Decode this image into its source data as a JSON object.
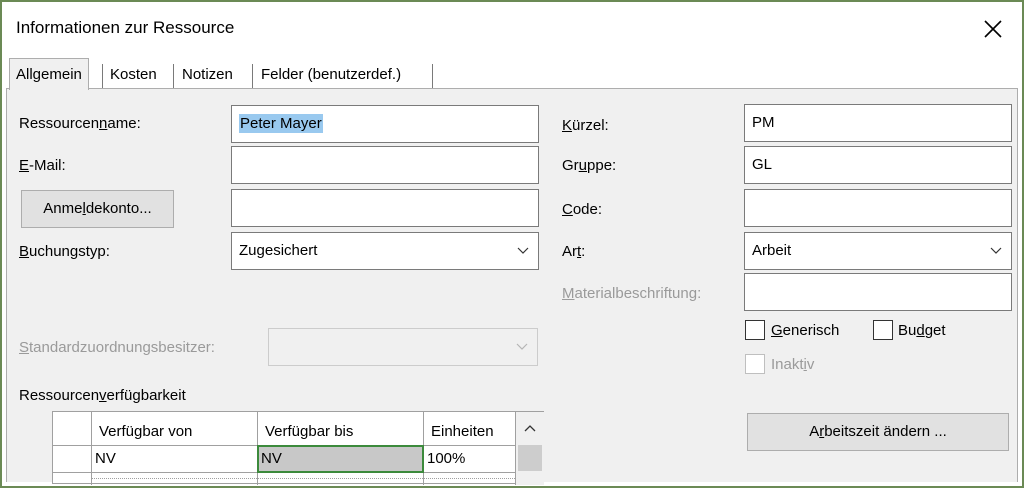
{
  "window": {
    "title": "Informationen zur Ressource"
  },
  "tabs": [
    {
      "label": "Allgemein",
      "selected": true
    },
    {
      "label": "Kosten",
      "selected": false
    },
    {
      "label": "Notizen",
      "selected": false
    },
    {
      "label": "Felder (benutzerdef.)",
      "selected": false
    }
  ],
  "form": {
    "resource_name": {
      "label_pre": "Ressourcen",
      "label_ul": "n",
      "label_post": "ame:",
      "value": "Peter Mayer"
    },
    "email": {
      "label_pre": "",
      "label_ul": "E",
      "label_post": "-Mail:",
      "value": ""
    },
    "login_button": {
      "label_pre": "Anme",
      "label_ul": "l",
      "label_post": "dekonto...",
      "value": ""
    },
    "booking_type": {
      "label_pre": "",
      "label_ul": "B",
      "label_post": "uchungstyp:",
      "value": "Zugesichert"
    },
    "default_owner": {
      "label_pre": "",
      "label_ul": "S",
      "label_post": "tandardzuordnungsbesitzer:",
      "value": ""
    },
    "initials": {
      "label_pre": "",
      "label_ul": "K",
      "label_post": "ürzel:",
      "value": "PM"
    },
    "group": {
      "label_pre": "Gr",
      "label_ul": "u",
      "label_post": "ppe:",
      "value": "GL"
    },
    "code": {
      "label_pre": "",
      "label_ul": "C",
      "label_post": "ode:",
      "value": ""
    },
    "type": {
      "label_pre": "Ar",
      "label_ul": "t",
      "label_post": ":",
      "value": "Arbeit"
    },
    "material_label": {
      "label_pre": "",
      "label_ul": "M",
      "label_post": "aterialbeschriftung:",
      "value": ""
    },
    "generic": {
      "label_pre": "",
      "label_ul": "G",
      "label_post": "enerisch",
      "checked": false
    },
    "budget": {
      "label_pre": "Bu",
      "label_ul": "d",
      "label_post": "get",
      "checked": false
    },
    "inactive": {
      "label_pre": "Inakt",
      "label_ul": "i",
      "label_post": "v",
      "checked": false
    }
  },
  "availability": {
    "label_pre": "Ressourcen",
    "label_ul": "v",
    "label_post": "erfügbarkeit",
    "columns": [
      "Verfügbar von",
      "Verfügbar bis",
      "Einheiten"
    ],
    "rows": [
      {
        "from": "NV",
        "to": "NV",
        "units": "100%"
      }
    ]
  },
  "change_worktime_button": {
    "label_pre": "A",
    "label_ul": "r",
    "label_post": "beitszeit ändern ..."
  },
  "colors": {
    "accent_border": "#6b8a55",
    "selection": "#99c9ef",
    "grid_active": "#3c8a3c"
  }
}
